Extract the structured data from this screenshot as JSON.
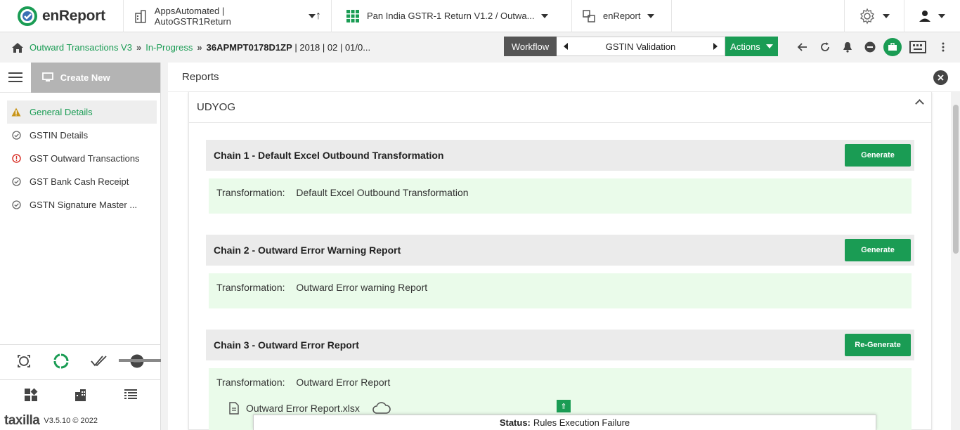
{
  "brand": {
    "name": "enReport",
    "footer_brand": "taxilla",
    "version": "V3.5.10 © 2022"
  },
  "topbar": {
    "org": "AppsAutomated | AutoGSTR1Return",
    "app": "Pan India GSTR-1 Return V1.2 / Outwa...",
    "product": "enReport"
  },
  "breadcrumb": {
    "items": [
      "Outward Transactions V3",
      "In-Progress"
    ],
    "separator": "»",
    "current_id": "36APMPT0178D1ZP",
    "current_rest": " | 2018 | 02 | 01/0..."
  },
  "workflow": {
    "label": "Workflow",
    "step": "GSTIN Validation",
    "actions_label": "Actions"
  },
  "sidebar": {
    "create_new": "Create New",
    "items": [
      {
        "label": "General Details",
        "icon": "warning-icon",
        "active": true
      },
      {
        "label": "GSTIN Details",
        "icon": "check-circle-icon",
        "active": false
      },
      {
        "label": "GST Outward Transactions",
        "icon": "error-icon",
        "active": false
      },
      {
        "label": "GST Bank Cash Receipt",
        "icon": "check-circle-icon",
        "active": false
      },
      {
        "label": "GSTN Signature Master ...",
        "icon": "check-circle-icon",
        "active": false
      }
    ]
  },
  "main": {
    "title": "Reports",
    "section": "UDYOG",
    "chains": [
      {
        "title": "Chain 1 - Default Excel Outbound Transformation",
        "button": "Generate",
        "transformation_label": "Transformation:",
        "transformation": "Default Excel Outbound Transformation"
      },
      {
        "title": "Chain 2 - Outward Error Warning Report",
        "button": "Generate",
        "transformation_label": "Transformation:",
        "transformation": "Outward Error warning Report"
      },
      {
        "title": "Chain 3 - Outward Error Report",
        "button": "Re-Generate",
        "transformation_label": "Transformation:",
        "transformation": "Outward Error Report",
        "file": "Outward Error Report.xlsx"
      }
    ]
  },
  "status": {
    "label": "Status:",
    "value": "Rules Execution Failure"
  },
  "colors": {
    "accent": "#1a9c54",
    "warning": "#c8951a",
    "error": "#d9342b"
  }
}
